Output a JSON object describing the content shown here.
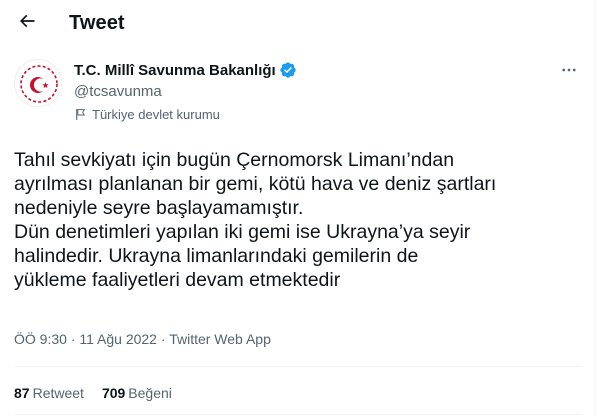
{
  "header": {
    "title": "Tweet",
    "back_icon": "arrow-left-icon"
  },
  "author": {
    "name": "T.C. Millî Savunma Bakanlığı",
    "handle": "@tcsavunma",
    "label": "Türkiye devlet kurumu",
    "verified_color": "#1d9bf0",
    "avatar_color": "#c8102e"
  },
  "tweet": {
    "lines": [
      "Tahıl sevkiyatı için bugün Çernomorsk Limanı’ndan",
      "ayrılması planlanan bir gemi, kötü hava ve deniz şartları",
      "nedeniyle seyre başlayamamıştır.",
      "Dün denetimleri yapılan iki gemi ise Ukrayna’ya seyir",
      "halindedir. Ukrayna limanlarındaki gemilerin de",
      "yükleme faaliyetleri devam etmektedir"
    ],
    "time": "ÖÖ 9:30",
    "date": "11 Ağu 2022",
    "separator": "·",
    "source": "Twitter Web App"
  },
  "stats": {
    "retweets_count": "87",
    "retweets_label": "Retweet",
    "likes_count": "709",
    "likes_label": "Beğeni"
  }
}
